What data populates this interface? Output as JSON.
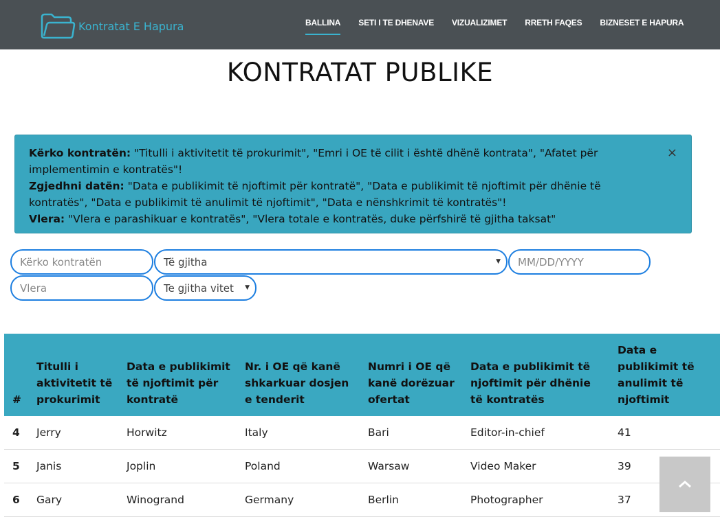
{
  "brand": {
    "name": "Kontratat E Hapura",
    "icon": "folder-icon",
    "accent": "#3ab3cf"
  },
  "nav": {
    "items": [
      {
        "label": "BALLINA",
        "active": true
      },
      {
        "label": "SETI I TE DHENAVE",
        "active": false
      },
      {
        "label": "VIZUALIZIMET",
        "active": false
      },
      {
        "label": "RRETH FAQES",
        "active": false
      },
      {
        "label": "BIZNESET E HAPURA",
        "active": false
      }
    ]
  },
  "page": {
    "title": "KONTRATAT PUBLIKE"
  },
  "alert": {
    "line1_label": "Kërko kontratën:",
    "line1_text": " \"Titulli i aktivitetit të prokurimit\", \"Emri i OE të cilit i është dhënë kontrata\", \"Afatet për implementimin e kontratës\"!",
    "line2_label": "Zgjedhni datën:",
    "line2_text": " \"Data e publikimit të njoftimit për kontratë\", \"Data e publikimit të njoftimit për dhënie të kontratës\", \"Data e publikimit të anulimit të njoftimit\", \"Data e nënshkrimit të kontratës\"!",
    "line3_label": "Vlera:",
    "line3_text": " \"Vlera e parashikuar e kontratës\", \"Vlera totale e kontratës, duke përfshirë të gjitha taksat\"",
    "close_label": "×",
    "color": "#39a6bf"
  },
  "filters": {
    "search_placeholder": "Kërko kontratën",
    "type_select": "Të gjitha",
    "date_placeholder": "MM/DD/YYYY",
    "value_placeholder": "Vlera",
    "year_select": "Te gjitha vitet"
  },
  "table": {
    "headers": [
      "#",
      "Titulli i aktivitetit të prokurimit",
      "Data e publikimit të njoftimit për kontratë",
      "Nr. i OE që kanë shkarkuar dosjen e tenderit",
      "Numri i OE që kanë dorëzuar ofertat",
      "Data e publikimit të njoftimit për dhënie të kontratës",
      "Data e publikimit të anulimit të njoftimit"
    ],
    "rows": [
      [
        "4",
        "Jerry",
        "Horwitz",
        "Italy",
        "Bari",
        "Editor-in-chief",
        "41"
      ],
      [
        "5",
        "Janis",
        "Joplin",
        "Poland",
        "Warsaw",
        "Video Maker",
        "39"
      ],
      [
        "6",
        "Gary",
        "Winogrand",
        "Germany",
        "Berlin",
        "Photographer",
        "37"
      ]
    ]
  },
  "back_to_top": {
    "icon": "chevron-up-icon"
  }
}
